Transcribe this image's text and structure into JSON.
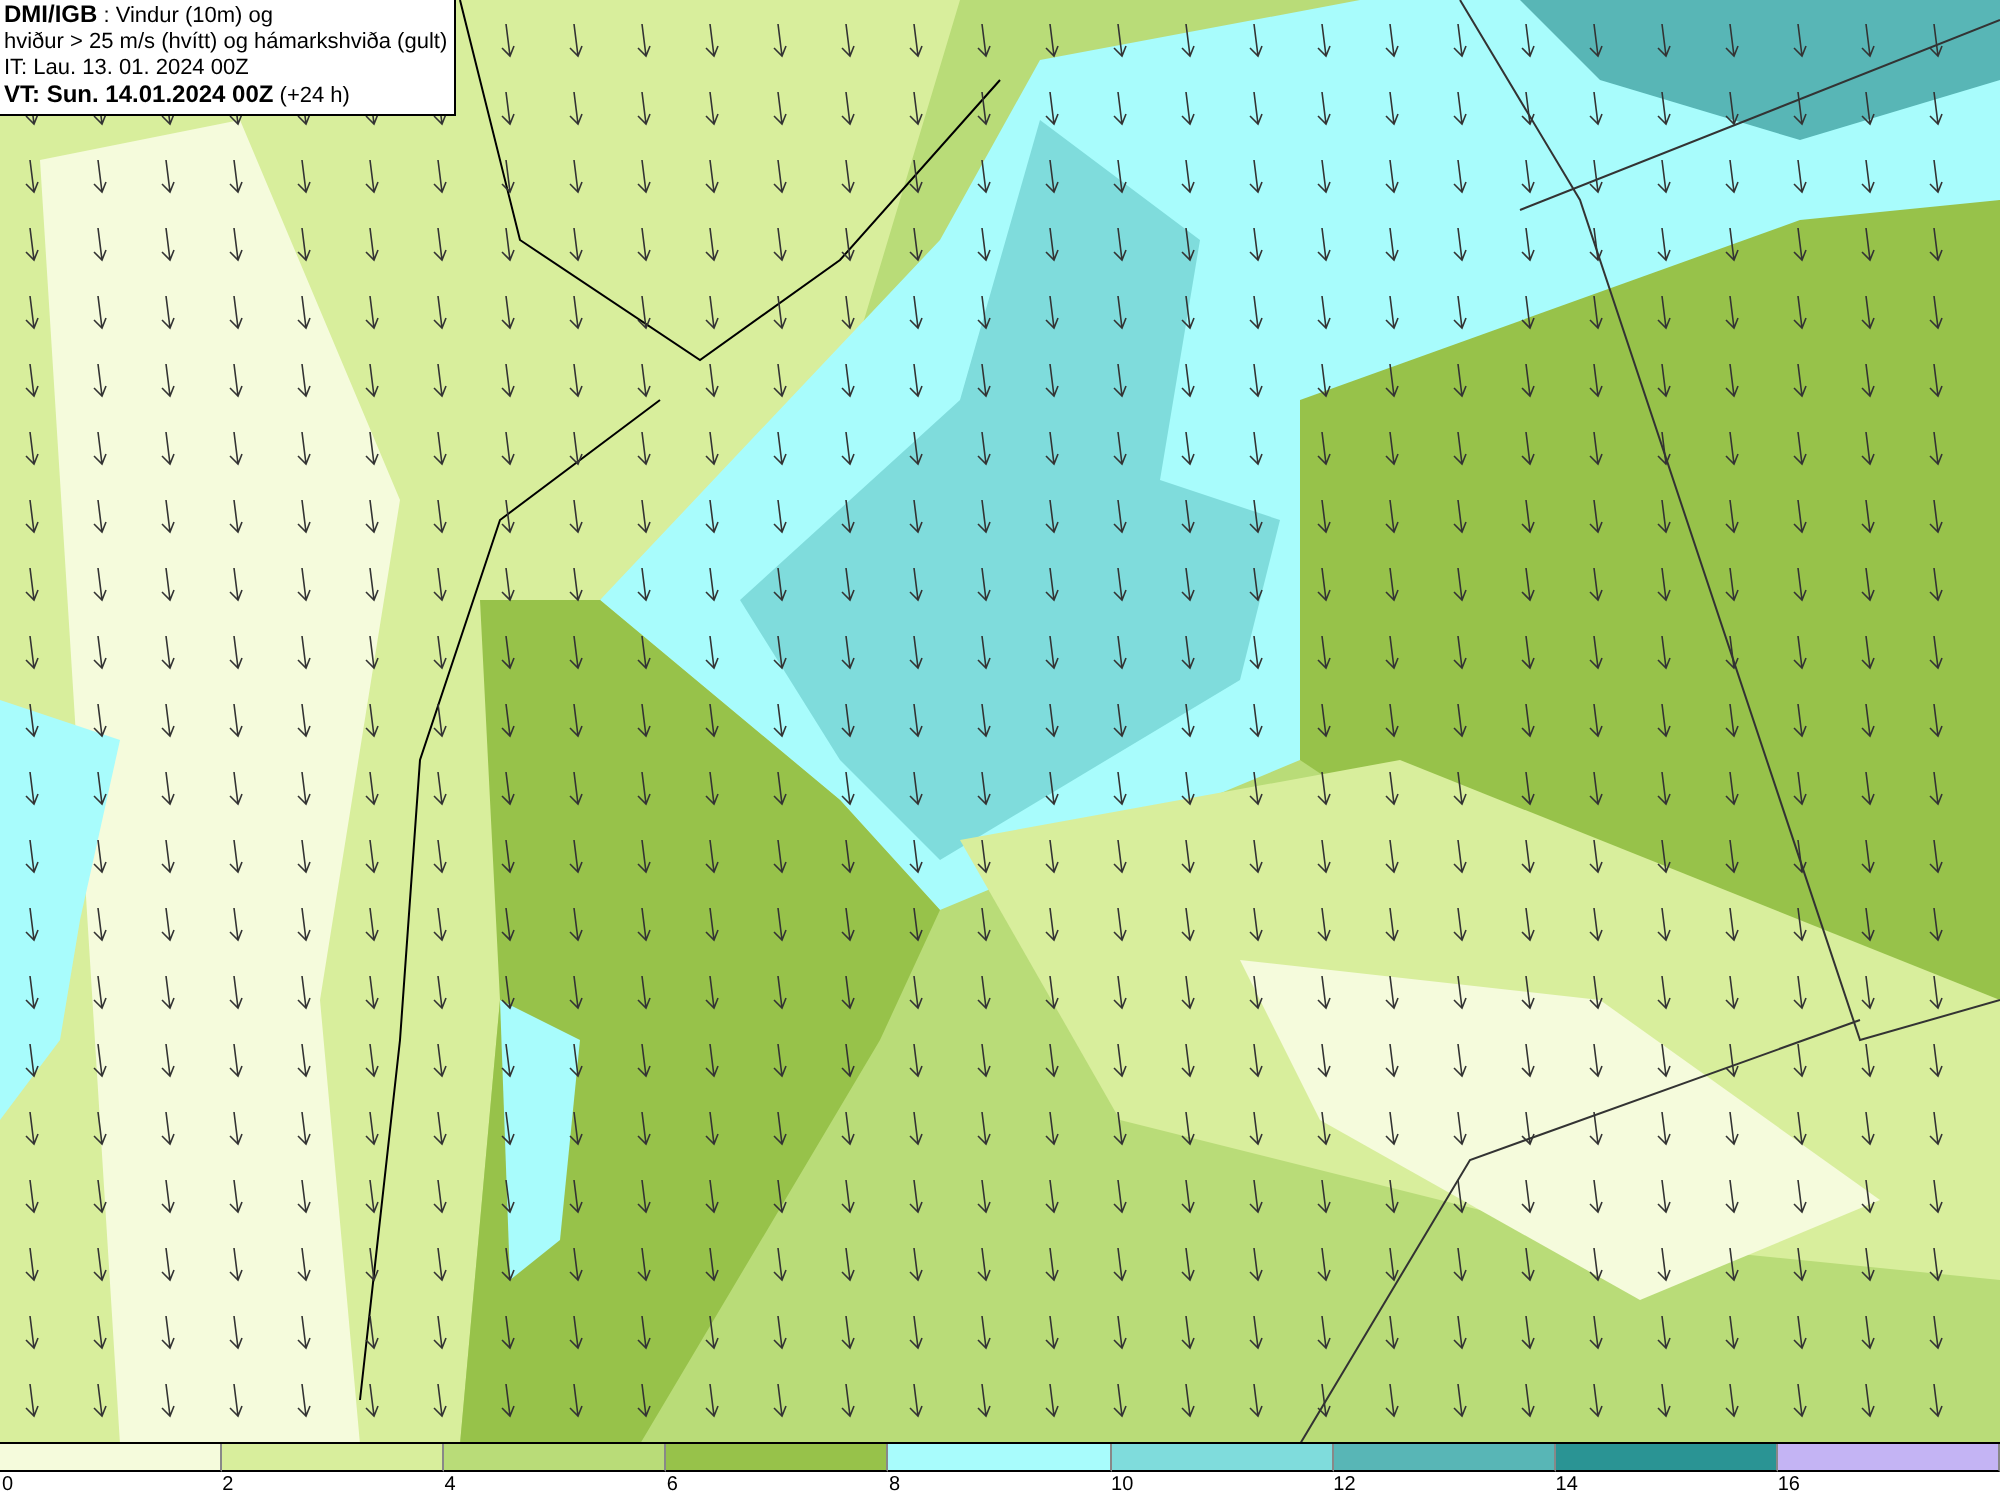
{
  "header": {
    "lines": [
      "**DMI/IGB** : Vindur (10m) og",
      "hviður > 25 m/s (hvítt) og hámarkshviða (gult)",
      "IT: Lau. 13. 01. 2024 00Z",
      "**VT: Sun. 14.01.2024 00Z** (+24 h)"
    ]
  },
  "legend": [
    {
      "label": "0",
      "color": "#f5fbdc"
    },
    {
      "label": "2",
      "color": "#d8ee9c"
    },
    {
      "label": "4",
      "color": "#b9dc78"
    },
    {
      "label": "6",
      "color": "#97c24a"
    },
    {
      "label": "8",
      "color": "#a8fcfc"
    },
    {
      "label": "10",
      "color": "#7fdcdc"
    },
    {
      "label": "12",
      "color": "#58b6b6"
    },
    {
      "label": "14",
      "color": "#2a9494"
    },
    {
      "label": "16",
      "color": "#c4b4f4"
    }
  ]
}
